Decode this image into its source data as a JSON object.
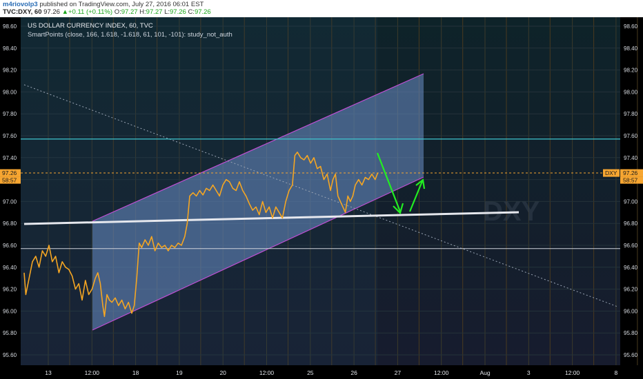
{
  "header": {
    "author": "m4riovolp3",
    "published": "published on TradingView.com, July 27, 2016 06:01 EST",
    "symbol": "TVC:DXY, 60",
    "price": "97.26",
    "change": "+0.11 (+0.11%)",
    "o_label": "O:",
    "o_value": "97.27",
    "h_label": "H:",
    "h_value": "97.27",
    "l_label": "L:",
    "l_value": "97.26",
    "c_label": "C:",
    "c_value": "97.26"
  },
  "chart_data": {
    "type": "line",
    "title": "US DOLLAR CURRENCY INDEX, 60, TVC",
    "subtitle": "SmartPoints (close, 166, 1.618, -1.618, 61, 101, -101): study_not_auth",
    "watermark": "DXY",
    "ylim": [
      95.45,
      98.75
    ],
    "y_ticks": [
      98.6,
      98.4,
      98.2,
      98.0,
      97.8,
      97.6,
      97.4,
      97.2,
      97.0,
      96.8,
      96.6,
      96.4,
      96.2,
      96.0,
      95.8,
      95.6
    ],
    "x_ticks": [
      "13",
      "12:00",
      "18",
      "19",
      "20",
      "12:00",
      "25",
      "26",
      "27",
      "12:00",
      "Aug",
      "3",
      "12:00",
      "8"
    ],
    "last_price": 97.26,
    "last_price_label": "97.26",
    "countdown": "58:57",
    "series_label": "DXY",
    "hlines": [
      {
        "value": 97.57,
        "color": "#3ec6cf"
      },
      {
        "value": 96.57,
        "color": "#cfd3dc"
      }
    ],
    "close_series": [
      {
        "x": 0.0,
        "y": 96.35
      },
      {
        "x": 0.02,
        "y": 96.15
      },
      {
        "x": 0.06,
        "y": 96.3
      },
      {
        "x": 0.1,
        "y": 96.45
      },
      {
        "x": 0.14,
        "y": 96.5
      },
      {
        "x": 0.18,
        "y": 96.4
      },
      {
        "x": 0.22,
        "y": 96.55
      },
      {
        "x": 0.26,
        "y": 96.5
      },
      {
        "x": 0.3,
        "y": 96.6
      },
      {
        "x": 0.34,
        "y": 96.45
      },
      {
        "x": 0.38,
        "y": 96.5
      },
      {
        "x": 0.42,
        "y": 96.35
      },
      {
        "x": 0.46,
        "y": 96.45
      },
      {
        "x": 0.5,
        "y": 96.4
      },
      {
        "x": 0.54,
        "y": 96.38
      },
      {
        "x": 0.58,
        "y": 96.32
      },
      {
        "x": 0.62,
        "y": 96.2
      },
      {
        "x": 0.66,
        "y": 96.25
      },
      {
        "x": 0.7,
        "y": 96.1
      },
      {
        "x": 0.74,
        "y": 96.28
      },
      {
        "x": 0.78,
        "y": 96.15
      },
      {
        "x": 0.82,
        "y": 96.2
      },
      {
        "x": 0.86,
        "y": 96.3
      },
      {
        "x": 0.89,
        "y": 96.35
      },
      {
        "x": 0.92,
        "y": 96.25
      },
      {
        "x": 0.95,
        "y": 96.05
      },
      {
        "x": 0.97,
        "y": 95.95
      },
      {
        "x": 1.0,
        "y": 96.15
      },
      {
        "x": 1.03,
        "y": 96.1
      },
      {
        "x": 1.06,
        "y": 96.08
      },
      {
        "x": 1.1,
        "y": 96.12
      },
      {
        "x": 1.14,
        "y": 96.05
      },
      {
        "x": 1.18,
        "y": 96.1
      },
      {
        "x": 1.22,
        "y": 96.02
      },
      {
        "x": 1.26,
        "y": 96.08
      },
      {
        "x": 1.3,
        "y": 95.98
      },
      {
        "x": 1.33,
        "y": 96.05
      },
      {
        "x": 1.36,
        "y": 96.3
      },
      {
        "x": 1.39,
        "y": 96.62
      },
      {
        "x": 1.42,
        "y": 96.58
      },
      {
        "x": 1.46,
        "y": 96.65
      },
      {
        "x": 1.5,
        "y": 96.6
      },
      {
        "x": 1.54,
        "y": 96.68
      },
      {
        "x": 1.58,
        "y": 96.55
      },
      {
        "x": 1.62,
        "y": 96.62
      },
      {
        "x": 1.66,
        "y": 96.58
      },
      {
        "x": 1.7,
        "y": 96.6
      },
      {
        "x": 1.74,
        "y": 96.55
      },
      {
        "x": 1.78,
        "y": 96.6
      },
      {
        "x": 1.82,
        "y": 96.58
      },
      {
        "x": 1.86,
        "y": 96.62
      },
      {
        "x": 1.9,
        "y": 96.6
      },
      {
        "x": 1.94,
        "y": 96.68
      },
      {
        "x": 1.97,
        "y": 96.8
      },
      {
        "x": 2.0,
        "y": 97.05
      },
      {
        "x": 2.04,
        "y": 97.08
      },
      {
        "x": 2.08,
        "y": 97.05
      },
      {
        "x": 2.12,
        "y": 97.1
      },
      {
        "x": 2.16,
        "y": 97.06
      },
      {
        "x": 2.2,
        "y": 97.12
      },
      {
        "x": 2.24,
        "y": 97.1
      },
      {
        "x": 2.28,
        "y": 97.15
      },
      {
        "x": 2.32,
        "y": 97.1
      },
      {
        "x": 2.36,
        "y": 97.05
      },
      {
        "x": 2.4,
        "y": 97.15
      },
      {
        "x": 2.44,
        "y": 97.2
      },
      {
        "x": 2.48,
        "y": 97.18
      },
      {
        "x": 2.52,
        "y": 97.12
      },
      {
        "x": 2.56,
        "y": 97.1
      },
      {
        "x": 2.6,
        "y": 97.18
      },
      {
        "x": 2.64,
        "y": 97.1
      },
      {
        "x": 2.68,
        "y": 97.05
      },
      {
        "x": 2.72,
        "y": 96.98
      },
      {
        "x": 2.76,
        "y": 96.92
      },
      {
        "x": 2.8,
        "y": 96.95
      },
      {
        "x": 2.84,
        "y": 96.88
      },
      {
        "x": 2.88,
        "y": 97.0
      },
      {
        "x": 2.92,
        "y": 96.9
      },
      {
        "x": 2.96,
        "y": 96.95
      },
      {
        "x": 3.0,
        "y": 96.85
      },
      {
        "x": 3.04,
        "y": 96.95
      },
      {
        "x": 3.08,
        "y": 96.9
      },
      {
        "x": 3.12,
        "y": 96.85
      },
      {
        "x": 3.16,
        "y": 97.0
      },
      {
        "x": 3.2,
        "y": 97.1
      },
      {
        "x": 3.24,
        "y": 97.15
      },
      {
        "x": 3.27,
        "y": 97.42
      },
      {
        "x": 3.3,
        "y": 97.45
      },
      {
        "x": 3.34,
        "y": 97.4
      },
      {
        "x": 3.38,
        "y": 97.38
      },
      {
        "x": 3.42,
        "y": 97.42
      },
      {
        "x": 3.46,
        "y": 97.35
      },
      {
        "x": 3.5,
        "y": 97.4
      },
      {
        "x": 3.54,
        "y": 97.3
      },
      {
        "x": 3.58,
        "y": 97.32
      },
      {
        "x": 3.62,
        "y": 97.2
      },
      {
        "x": 3.66,
        "y": 97.25
      },
      {
        "x": 3.7,
        "y": 97.1
      },
      {
        "x": 3.73,
        "y": 97.2
      },
      {
        "x": 3.76,
        "y": 97.25
      },
      {
        "x": 3.79,
        "y": 97.05
      },
      {
        "x": 3.82,
        "y": 97.0
      },
      {
        "x": 3.85,
        "y": 96.95
      },
      {
        "x": 3.88,
        "y": 96.9
      },
      {
        "x": 3.91,
        "y": 97.05
      },
      {
        "x": 3.94,
        "y": 97.0
      },
      {
        "x": 3.97,
        "y": 97.05
      },
      {
        "x": 4.0,
        "y": 97.15
      },
      {
        "x": 4.04,
        "y": 97.2
      },
      {
        "x": 4.08,
        "y": 97.15
      },
      {
        "x": 4.12,
        "y": 97.22
      },
      {
        "x": 4.16,
        "y": 97.2
      },
      {
        "x": 4.2,
        "y": 97.25
      },
      {
        "x": 4.24,
        "y": 97.2
      },
      {
        "x": 4.27,
        "y": 97.26
      }
    ]
  }
}
